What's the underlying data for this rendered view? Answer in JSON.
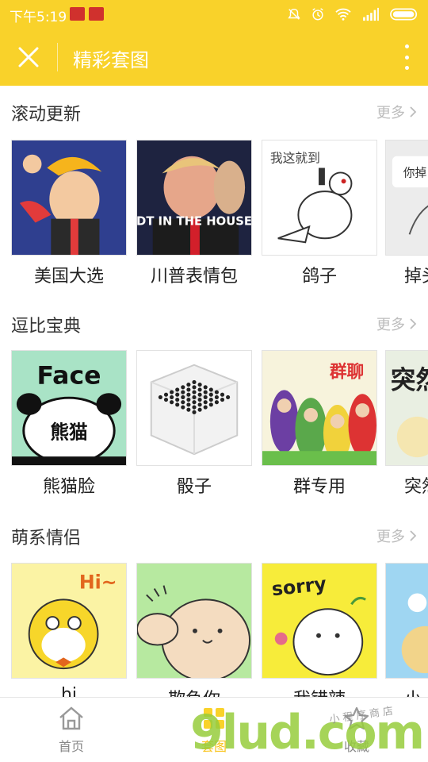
{
  "status_bar": {
    "time": "下午5:19",
    "icons": [
      "netease-app-icon",
      "other-app-icon",
      "mute-icon",
      "alarm-icon",
      "wifi-icon",
      "signal-icon",
      "battery-icon"
    ]
  },
  "app_bar": {
    "title": "精彩套图",
    "close_icon": "close-icon",
    "menu_icon": "more-vert-icon"
  },
  "sections": [
    {
      "title": "滚动更新",
      "more": "更多",
      "items": [
        {
          "label": "美国大选"
        },
        {
          "label": "川普表情包",
          "image_text": "DT IN THE HOUSE"
        },
        {
          "label": "鸽子",
          "image_text": "我这就到"
        },
        {
          "label": "掉头",
          "image_text": "你掉"
        }
      ]
    },
    {
      "title": "逗比宝典",
      "more": "更多",
      "items": [
        {
          "label": "熊猫脸",
          "image_text": "Face",
          "image_text_2": "熊猫"
        },
        {
          "label": "骰子"
        },
        {
          "label": "群专用",
          "image_text": "群聊"
        },
        {
          "label": "突然",
          "image_text": "突然"
        }
      ]
    },
    {
      "title": "萌系情侣",
      "more": "更多",
      "items": [
        {
          "label": "hi",
          "image_text": "Hi~"
        },
        {
          "label": "欺负你"
        },
        {
          "label": "我错辣",
          "image_text": "sorry"
        },
        {
          "label": "小"
        }
      ]
    }
  ],
  "bottom_nav": [
    {
      "label": "首页",
      "icon": "home-icon"
    },
    {
      "label": "套图",
      "icon": "grid-icon"
    },
    {
      "label": "收藏",
      "icon": "star-icon"
    }
  ],
  "watermark": {
    "text": "9lud.com",
    "sub": "小程序商店"
  },
  "colors": {
    "accent": "#f9d22a",
    "text": "#222222",
    "muted": "#bcbcbc"
  }
}
